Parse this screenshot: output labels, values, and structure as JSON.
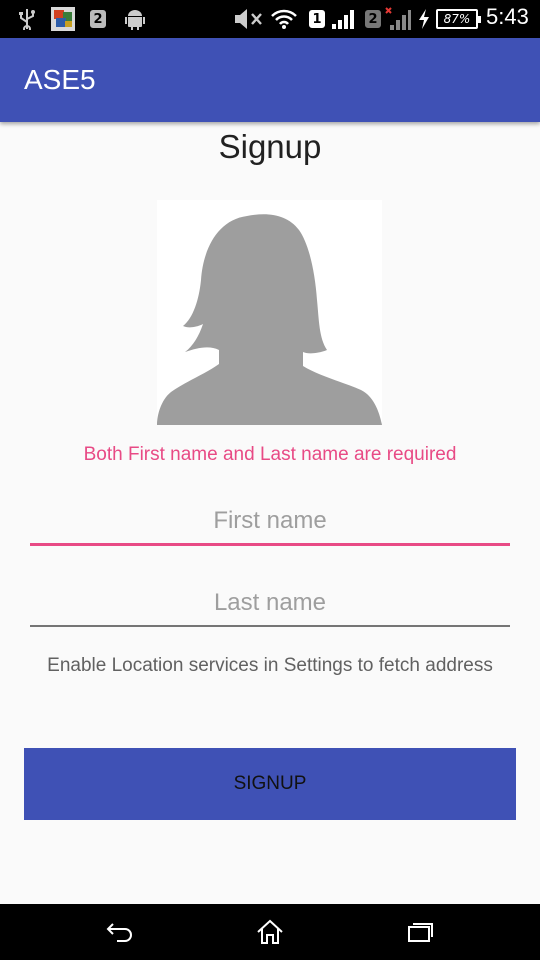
{
  "status_bar": {
    "sim1": "1",
    "sim2": "2",
    "notification_badge": "2",
    "battery": "87%",
    "time": "5:43"
  },
  "app_bar": {
    "title": "ASE5"
  },
  "page": {
    "title": "Signup",
    "error_message": "Both First name and Last name are required",
    "first_name": {
      "value": "",
      "placeholder": "First name"
    },
    "last_name": {
      "value": "",
      "placeholder": "Last name"
    },
    "location_hint": "Enable Location services in Settings to fetch address",
    "signup_label": "SIGNUP"
  },
  "nav_bar": {
    "buttons": [
      "back-icon",
      "home-icon",
      "recents-icon"
    ]
  },
  "colors": {
    "primary": "#3f51b5",
    "accent": "#e84a85",
    "background": "#fafafa"
  }
}
